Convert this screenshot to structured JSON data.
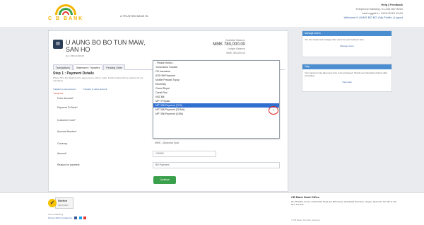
{
  "header": {
    "logo_text": "C B BANK",
    "tagline": "A TRUSTED BANK IN",
    "help_title": "Help | Feedback",
    "help_line2": "Telephone Banking: 01-234 567 8910",
    "help_line3": "Last logged in: 01/01/2015 10:00",
    "help_links": "Welcome U AUNG BO BO | My Profile | Logout"
  },
  "breadcrumb": {
    "home": "Home"
  },
  "service": {
    "title": "U AUNG BO BO TUN MAW, SAN HO",
    "subtitle": "Ref: MBKL0000000",
    "right_line1": "Available Balance",
    "right_number": "MMK 780,000.00",
    "right_line2": "Ledger Balance",
    "right_line3": "MMK 780,000.00"
  },
  "tabs": [
    "Transactions",
    "Statement / Transfers",
    "Pending Order"
  ],
  "step": {
    "title": "Step 1 : Payment Details",
    "desc": "Please fill in the details for the payment you wish to make. Fields marked with an asterisk (*) are mandatory."
  },
  "subtabs": [
    "Transfer to own account",
    "Transfer to other account"
  ],
  "required_note": "* Required",
  "form": {
    "labels": [
      "From Account*",
      "Payment To Bank*",
      "Customer Code*",
      "Account Number*",
      "Currency",
      "Amount*",
      "Reason for payment"
    ],
    "values": [
      "",
      "MPT Bill Payment (TCS)",
      "1234567",
      "1234567890",
      "MMK - Myanmar Kyat",
      "100000",
      "Bill Payment"
    ]
  },
  "dropdown": {
    "options": [
      "- Please Select -",
      "Yoma Bank Transfer",
      "CB Insurance",
      "AGD Bill Payment",
      "Mobile Prepaid Topup",
      "Electricity",
      "Grand Royal",
      "Canal Plus",
      "KBZ Bill",
      "MPT Prepaid",
      "MPT Bill Payment (TCS)",
      "MPT Bill Payment (CDMA)",
      "MPT Bill Payment (GSM)"
    ],
    "selected_index": 10
  },
  "continue_label": "Continue",
  "side1": {
    "title": "Manage Users",
    "body": "You can create and manage other users for your business here.",
    "link": "Manage Users"
  },
  "side2": {
    "title": "Help",
    "body": "Your payment may take some time to be processed. Check your transaction history after submitting.",
    "link": "View Help"
  },
  "footer": {
    "norton": "Norton",
    "norton_sub": "SECURED",
    "small": "Secure Banking",
    "links": "Terms | FAQ | Contact Us",
    "office_title": "CB Bank Head Office",
    "office_body": "No. 554-556, Corner of Merchant Road and 35th Street, Kyauktada Township, Yangon, Myanmar. Tel: (95-1) 372 641, 372 642",
    "copyright": "© CB Bank. All rights reserved."
  },
  "colors": {
    "accent": "#4a8dd0",
    "selected_option": "#2f6fd0",
    "continue_button": "#3aa04c",
    "annotation_circle": "#dd2222"
  }
}
